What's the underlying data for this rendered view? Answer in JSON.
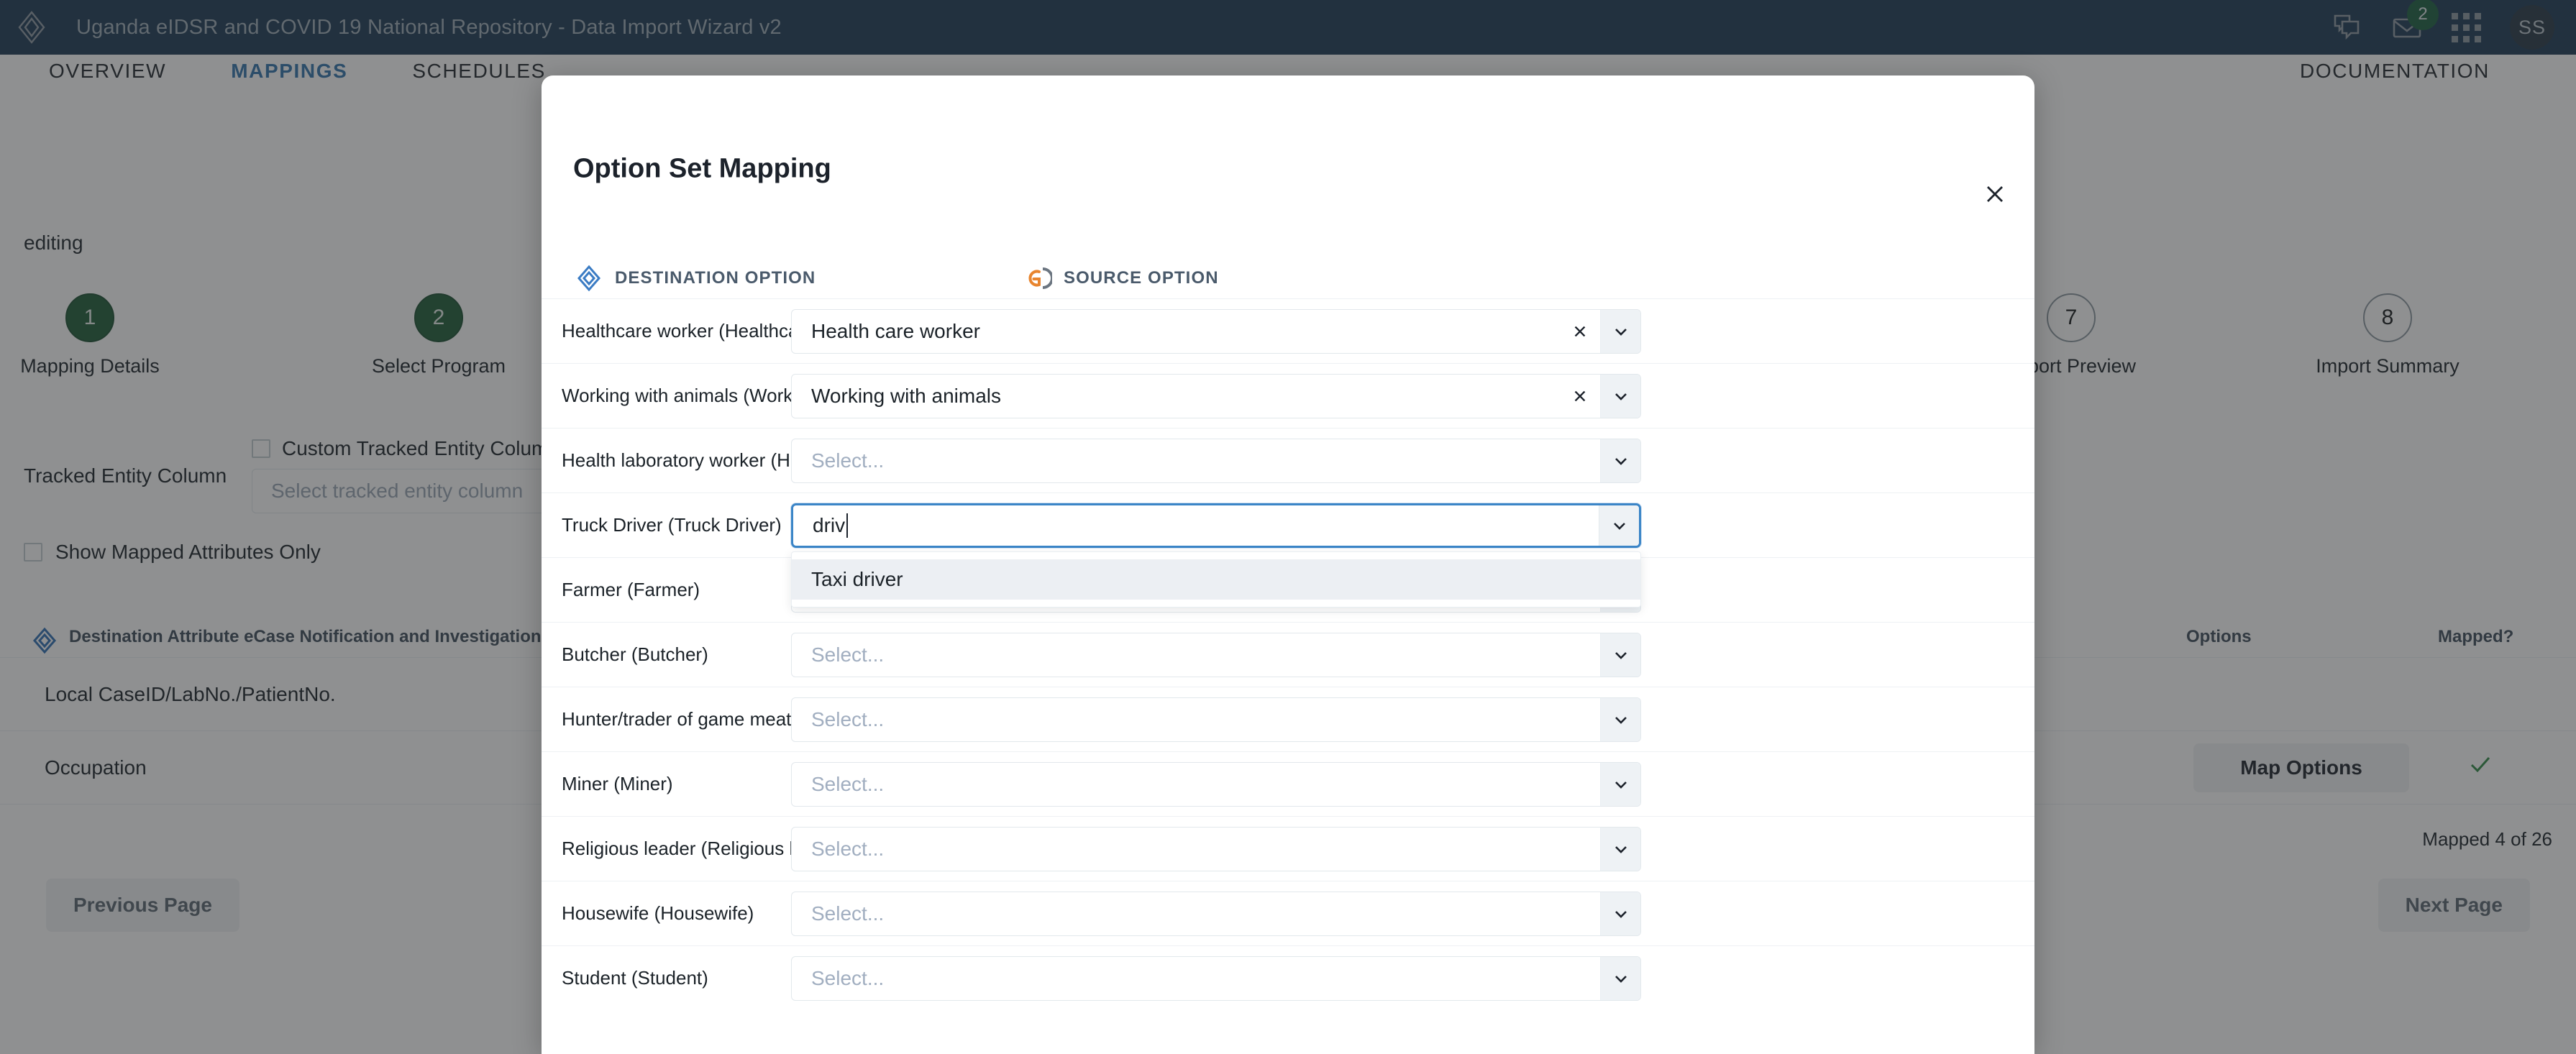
{
  "topbar": {
    "logo_icon": "layers-diamond-icon",
    "title": "Uganda eIDSR and COVID 19 National Repository - Data Import Wizard v2",
    "messages_icon": "chat-bubbles-icon",
    "mail_icon": "envelope-icon",
    "mail_badge": "2",
    "apps_icon": "apps-grid-icon",
    "avatar_initials": "SS"
  },
  "nav": {
    "items": [
      {
        "label": "OVERVIEW",
        "active": false
      },
      {
        "label": "MAPPINGS",
        "active": true
      },
      {
        "label": "SCHEDULES",
        "active": false
      }
    ],
    "documentation": "DOCUMENTATION"
  },
  "background": {
    "editing_label": "editing",
    "steps": [
      {
        "number": "1",
        "label": "Mapping Details",
        "state": "done"
      },
      {
        "number": "2",
        "label": "Select Program",
        "state": "done"
      },
      {
        "number": "7",
        "label": "Import Preview",
        "state": "todo"
      },
      {
        "number": "8",
        "label": "Import Summary",
        "state": "todo"
      }
    ],
    "tracked_entity_column_label": "Tracked Entity Column",
    "custom_tracked_entity_checkbox_label": "Custom Tracked Entity Column",
    "tracked_entity_placeholder": "Select tracked entity column",
    "show_mapped_attributes_label": "Show Mapped Attributes Only",
    "table": {
      "dest_icon": "layers-diamond-icon",
      "columns": [
        "Destination Attribute",
        "eCase Notification and Investigation",
        "Options",
        "Mapped?"
      ],
      "dest_header_combined": "Destination Attribute  eCase Notification and Investigation",
      "rows": [
        {
          "name": "Local CaseID/LabNo./PatientNo.",
          "has_clear": false,
          "has_map_options": false,
          "mapped": false
        },
        {
          "name": "Occupation",
          "has_clear": true,
          "has_map_options": true,
          "map_options_label": "Map Options",
          "mapped": true,
          "mapped_icon": "check-icon"
        }
      ],
      "mapped_count": "Mapped 4 of 26"
    },
    "pager": {
      "previous_label": "Previous Page",
      "next_label": "Next Page"
    }
  },
  "modal": {
    "title": "Option Set Mapping",
    "close_icon": "close-icon",
    "columns": {
      "destination": {
        "label": "DESTINATION OPTION",
        "icon": "layers-diamond-icon"
      },
      "source": {
        "label": "SOURCE OPTION",
        "icon": "godata-g-icon"
      }
    },
    "placeholder": "Select...",
    "clear_icon": "close-icon",
    "caret_icon": "chevron-down-icon",
    "rows": [
      {
        "destination": "Healthcare worker (Healthcare worker)",
        "source": "Health care worker",
        "filled": true
      },
      {
        "destination": "Working with animals (Working with animals)",
        "source": "Working with animals",
        "filled": true
      },
      {
        "destination": "Health laboratory worker (Health laboratory worker )",
        "source": "",
        "filled": false
      },
      {
        "destination": "Truck Driver (Truck Driver)",
        "source": "driv",
        "filled": false,
        "focused": true,
        "typing": true
      },
      {
        "destination": "Farmer (Farmer)",
        "source": "",
        "filled": false
      },
      {
        "destination": "Butcher (Butcher)",
        "source": "",
        "filled": false
      },
      {
        "destination": "Hunter/trader of game meat (Hunter/trader of game meat)",
        "source": "",
        "filled": false
      },
      {
        "destination": "Miner (Miner)",
        "source": "",
        "filled": false
      },
      {
        "destination": "Religious leader (Religious leader)",
        "source": "",
        "filled": false
      },
      {
        "destination": "Housewife (Housewife)",
        "source": "",
        "filled": false
      },
      {
        "destination": "Student (Student)",
        "source": "",
        "filled": false
      }
    ],
    "suggestions": {
      "for_row_index": 3,
      "items": [
        {
          "label": "Taxi driver",
          "highlighted": true
        }
      ]
    }
  },
  "colors": {
    "topbar_bg": "#1d3a55",
    "nav_active": "#3073ac",
    "step_done_bg": "#1e5c38",
    "focus_border": "#3b85c7",
    "dest_icon": "#3b7cc4",
    "source_icon_orange": "#e8852f",
    "source_icon_gray": "#6b7580",
    "mapped_check": "#2e8b45",
    "scrim": "rgba(40,42,45,0.52)"
  }
}
